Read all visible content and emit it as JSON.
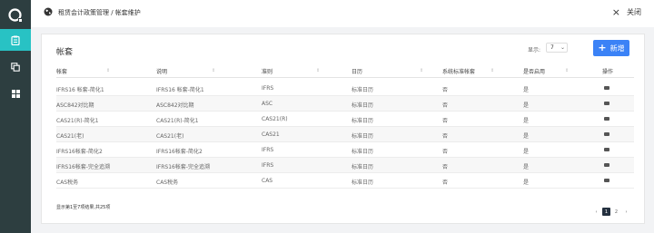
{
  "topbar": {
    "title": "租赁会计政策管理 / 帐套维护",
    "close_label": "关闭"
  },
  "sidebar": {
    "items": [
      {
        "icon": "clipboard-icon",
        "active": true
      },
      {
        "icon": "copy-icon",
        "active": false
      },
      {
        "icon": "grid-icon",
        "active": false
      }
    ]
  },
  "card": {
    "title": "帐套",
    "show_label": "显示:",
    "page_size": "7",
    "add_label": "新增"
  },
  "table": {
    "headers": [
      "帐套",
      "说明",
      "准则",
      "日历",
      "系统标准帐套",
      "是否启用",
      "操作"
    ],
    "rows": [
      [
        "IFRS16 帐套-简化1",
        "IFRS16 帐套-简化1",
        "IFRS",
        "标准日历",
        "否",
        "是"
      ],
      [
        "ASC842对比期",
        "ASC842对比期",
        "ASC",
        "标准日历",
        "否",
        "是"
      ],
      [
        "CAS21(R)-简化1",
        "CAS21(R)-简化1",
        "CAS21(R)",
        "标准日历",
        "否",
        "是"
      ],
      [
        "CAS21(老)",
        "CAS21(老)",
        "CAS21",
        "标准日历",
        "否",
        "是"
      ],
      [
        "IFRS16帐套-简化2",
        "IFRS16帐套-简化2",
        "IFRS",
        "标准日历",
        "否",
        "是"
      ],
      [
        "IFRS16帐套-完全追溯",
        "IFRS16帐套-完全追溯",
        "IFRS",
        "标准日历",
        "否",
        "是"
      ],
      [
        "CAS税务",
        "CAS税务",
        "CAS",
        "标准日历",
        "否",
        "是"
      ]
    ]
  },
  "footer": {
    "summary": "显示第1至7项结果,共25项",
    "prev": "‹",
    "pages": [
      "1",
      "2"
    ],
    "next": "›"
  },
  "colors": {
    "sidebar_bg": "#2d3e40",
    "sidebar_active": "#28c2c4",
    "primary": "#3b82f6",
    "pager_active": "#24303f"
  }
}
